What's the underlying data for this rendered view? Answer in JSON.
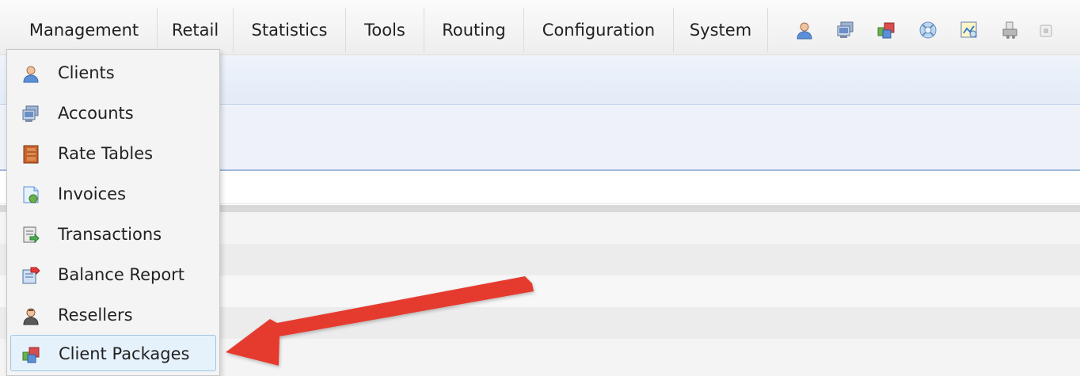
{
  "menubar": {
    "items": [
      {
        "label": "Management",
        "active": true
      },
      {
        "label": "Retail"
      },
      {
        "label": "Statistics"
      },
      {
        "label": "Tools"
      },
      {
        "label": "Routing"
      },
      {
        "label": "Configuration"
      },
      {
        "label": "System"
      }
    ],
    "active_underline_color": "#e8322b",
    "toolbar_icons": [
      "client-user-icon",
      "accounts-icon",
      "packages-icon",
      "globe-icon",
      "report-map-icon",
      "printer-icon",
      "small-box-icon"
    ]
  },
  "dropdown": {
    "items": [
      {
        "label": "Clients",
        "icon": "client-user-icon"
      },
      {
        "label": "Accounts",
        "icon": "accounts-icon"
      },
      {
        "label": "Rate Tables",
        "icon": "rate-book-icon"
      },
      {
        "label": "Invoices",
        "icon": "invoice-icon"
      },
      {
        "label": "Transactions",
        "icon": "transactions-icon"
      },
      {
        "label": "Balance Report",
        "icon": "balance-report-icon"
      },
      {
        "label": "Resellers",
        "icon": "reseller-icon"
      },
      {
        "label": "Client Packages",
        "icon": "packages-icon",
        "highlighted": true
      }
    ],
    "highlight_color": "#e6f2fb"
  },
  "annotation": {
    "type": "arrow",
    "color": "#e53a2f",
    "points_to": "Client Packages"
  }
}
